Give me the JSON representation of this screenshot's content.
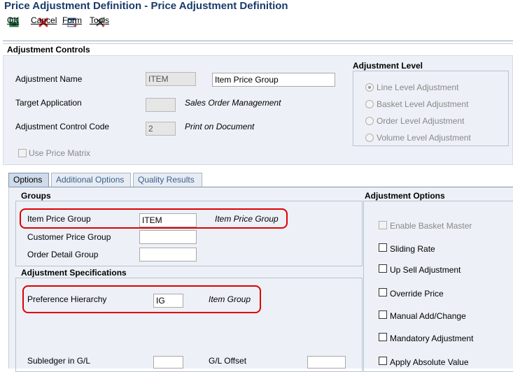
{
  "window": {
    "title": "Price Adjustment Definition - Price Adjustment Definition"
  },
  "toolbar": {
    "ok_label": "OK",
    "cancel_label": "Cancel",
    "form_label": "Form",
    "tools_label": "Tools"
  },
  "adjustment_controls": {
    "section_title": "Adjustment Controls",
    "adjustment_name_label": "Adjustment Name",
    "adjustment_name_code": "ITEM",
    "adjustment_name_desc": "Item Price Group",
    "target_application_label": "Target Application",
    "target_application_code": "",
    "target_application_desc": "Sales Order Management",
    "control_code_label": "Adjustment Control Code",
    "control_code_value": "2",
    "control_code_desc": "Print on Document",
    "use_price_matrix_label": "Use Price Matrix",
    "use_price_matrix_checked": false
  },
  "adjustment_level": {
    "title": "Adjustment Level",
    "options": [
      {
        "label": "Line Level Adjustment",
        "selected": true
      },
      {
        "label": "Basket Level Adjustment",
        "selected": false
      },
      {
        "label": "Order Level Adjustment",
        "selected": false
      },
      {
        "label": "Volume Level Adjustment",
        "selected": false
      }
    ]
  },
  "tabs": [
    {
      "label": "Options",
      "active": true
    },
    {
      "label": "Additional Options",
      "active": false
    },
    {
      "label": "Quality Results",
      "active": false
    }
  ],
  "groups": {
    "title": "Groups",
    "item_price_group_label": "Item Price Group",
    "item_price_group_value": "ITEM",
    "item_price_group_desc": "Item Price Group",
    "customer_price_group_label": "Customer Price Group",
    "customer_price_group_value": "",
    "order_detail_group_label": "Order Detail Group",
    "order_detail_group_value": ""
  },
  "adjustment_specifications": {
    "title": "Adjustment Specifications",
    "preference_hierarchy_label": "Preference Hierarchy",
    "preference_hierarchy_value": "IG",
    "preference_hierarchy_desc": "Item Group",
    "subledger_label": "Subledger in G/L",
    "subledger_value": "",
    "gl_offset_label": "G/L Offset",
    "gl_offset_value": ""
  },
  "adjustment_options": {
    "title": "Adjustment Options",
    "items": [
      {
        "label": "Enable Basket Master",
        "checked": false,
        "disabled": true
      },
      {
        "label": "Sliding Rate",
        "checked": false,
        "disabled": false
      },
      {
        "label": "Up Sell Adjustment",
        "checked": false,
        "disabled": false
      },
      {
        "label": "Override Price",
        "checked": false,
        "disabled": false
      },
      {
        "label": "Manual Add/Change",
        "checked": false,
        "disabled": false
      },
      {
        "label": "Mandatory Adjustment",
        "checked": false,
        "disabled": false
      },
      {
        "label": "Apply Absolute Value",
        "checked": false,
        "disabled": false
      }
    ]
  },
  "colors": {
    "title_text": "#1a3a6a",
    "panel_bg": "#edf1f7",
    "highlight_box": "#e00000",
    "tab_active_bg": "#cfdbea"
  }
}
